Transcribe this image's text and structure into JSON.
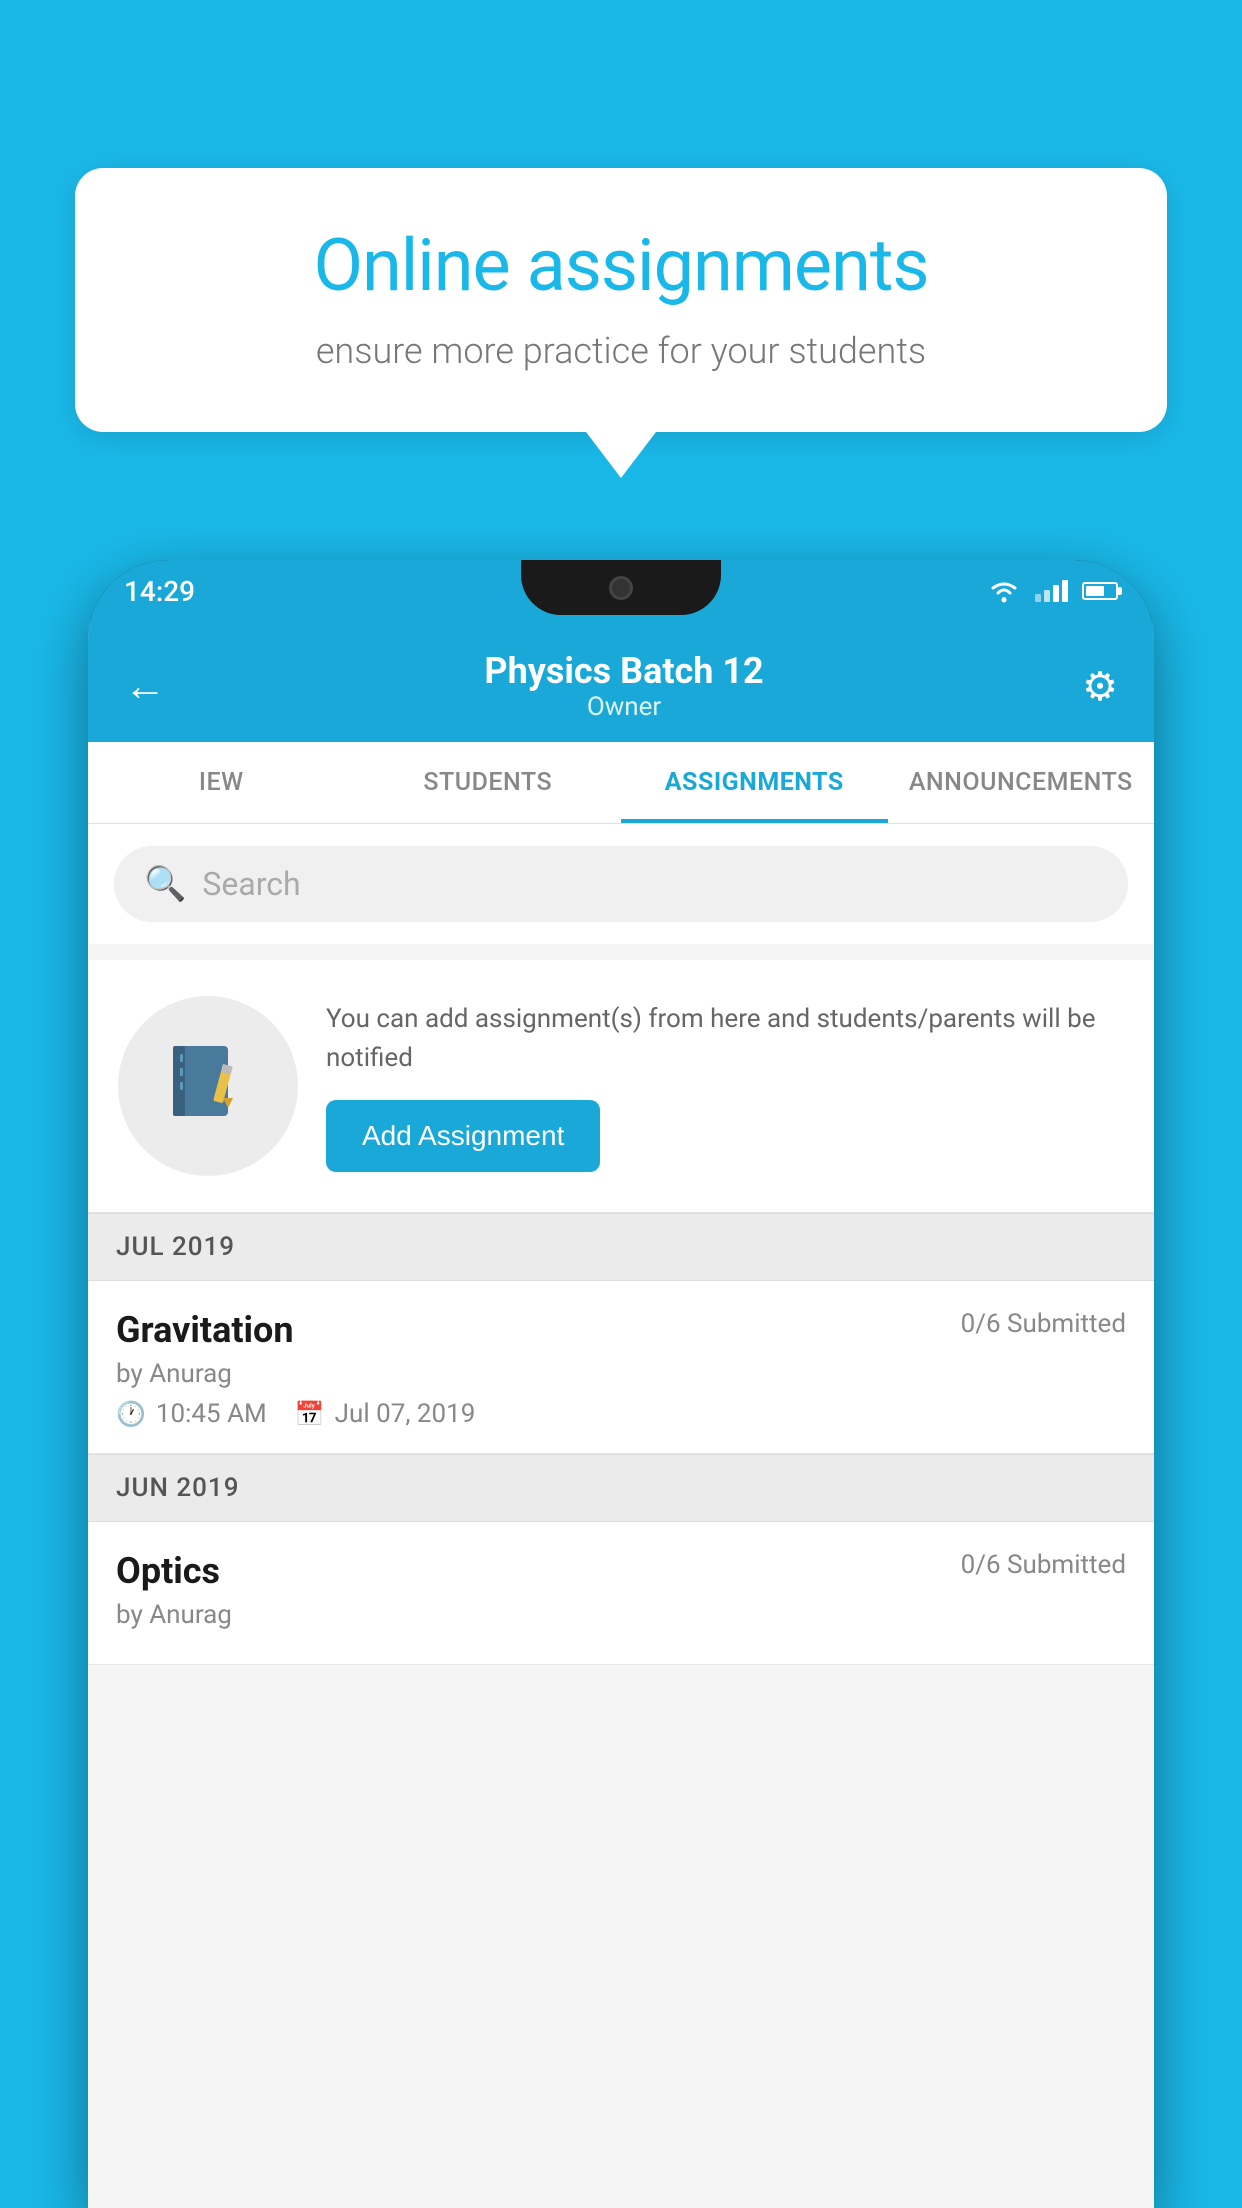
{
  "background_color": "#1ab8e8",
  "speech_bubble": {
    "title": "Online assignments",
    "subtitle": "ensure more practice for your students"
  },
  "phone": {
    "status_bar": {
      "time": "14:29"
    },
    "header": {
      "title": "Physics Batch 12",
      "subtitle": "Owner",
      "back_label": "←",
      "gear_label": "⚙"
    },
    "tabs": [
      {
        "label": "IEW",
        "active": false
      },
      {
        "label": "STUDENTS",
        "active": false
      },
      {
        "label": "ASSIGNMENTS",
        "active": true
      },
      {
        "label": "ANNOUNCEMENTS",
        "active": false
      }
    ],
    "search": {
      "placeholder": "Search"
    },
    "promo": {
      "text": "You can add assignment(s) from here and students/parents will be notified",
      "button_label": "Add Assignment"
    },
    "sections": [
      {
        "header": "JUL 2019",
        "assignments": [
          {
            "name": "Gravitation",
            "submitted": "0/6 Submitted",
            "by": "by Anurag",
            "time": "10:45 AM",
            "date": "Jul 07, 2019"
          }
        ]
      },
      {
        "header": "JUN 2019",
        "assignments": [
          {
            "name": "Optics",
            "submitted": "0/6 Submitted",
            "by": "by Anurag",
            "time": "",
            "date": ""
          }
        ]
      }
    ]
  }
}
